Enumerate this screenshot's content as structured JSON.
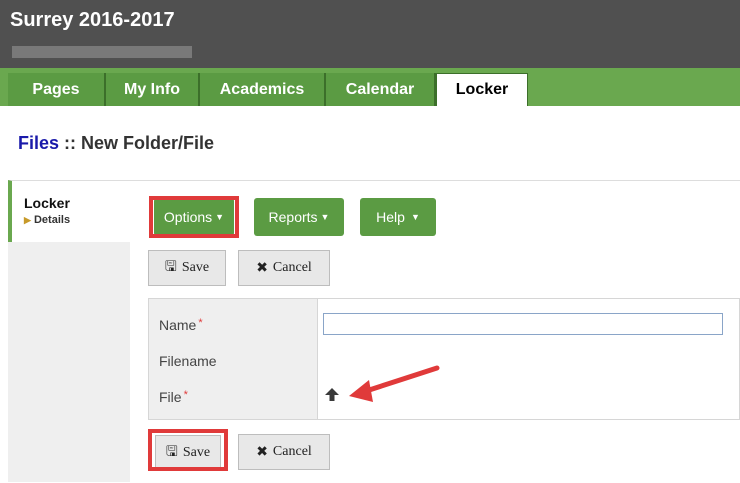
{
  "header": {
    "title": "Surrey 2016-2017"
  },
  "tabs": [
    {
      "label": "Pages"
    },
    {
      "label": "My Info"
    },
    {
      "label": "Academics"
    },
    {
      "label": "Calendar"
    },
    {
      "label": "Locker",
      "active": true
    }
  ],
  "breadcrumb": {
    "link": "Files",
    "separator": " :: ",
    "current": "New Folder/File"
  },
  "sidebar": {
    "item": "Locker",
    "sub": "Details"
  },
  "toolbar": {
    "options": "Options",
    "reports": "Reports",
    "help": "Help"
  },
  "actions": {
    "save": "Save",
    "cancel": "Cancel"
  },
  "form": {
    "name_label": "Name",
    "filename_label": "Filename",
    "file_label": "File",
    "required_marker": "*",
    "name_value": ""
  },
  "colors": {
    "green": "#5b9b43",
    "header": "#505050",
    "highlight": "#e03a3a",
    "link": "#1a1aaa"
  }
}
